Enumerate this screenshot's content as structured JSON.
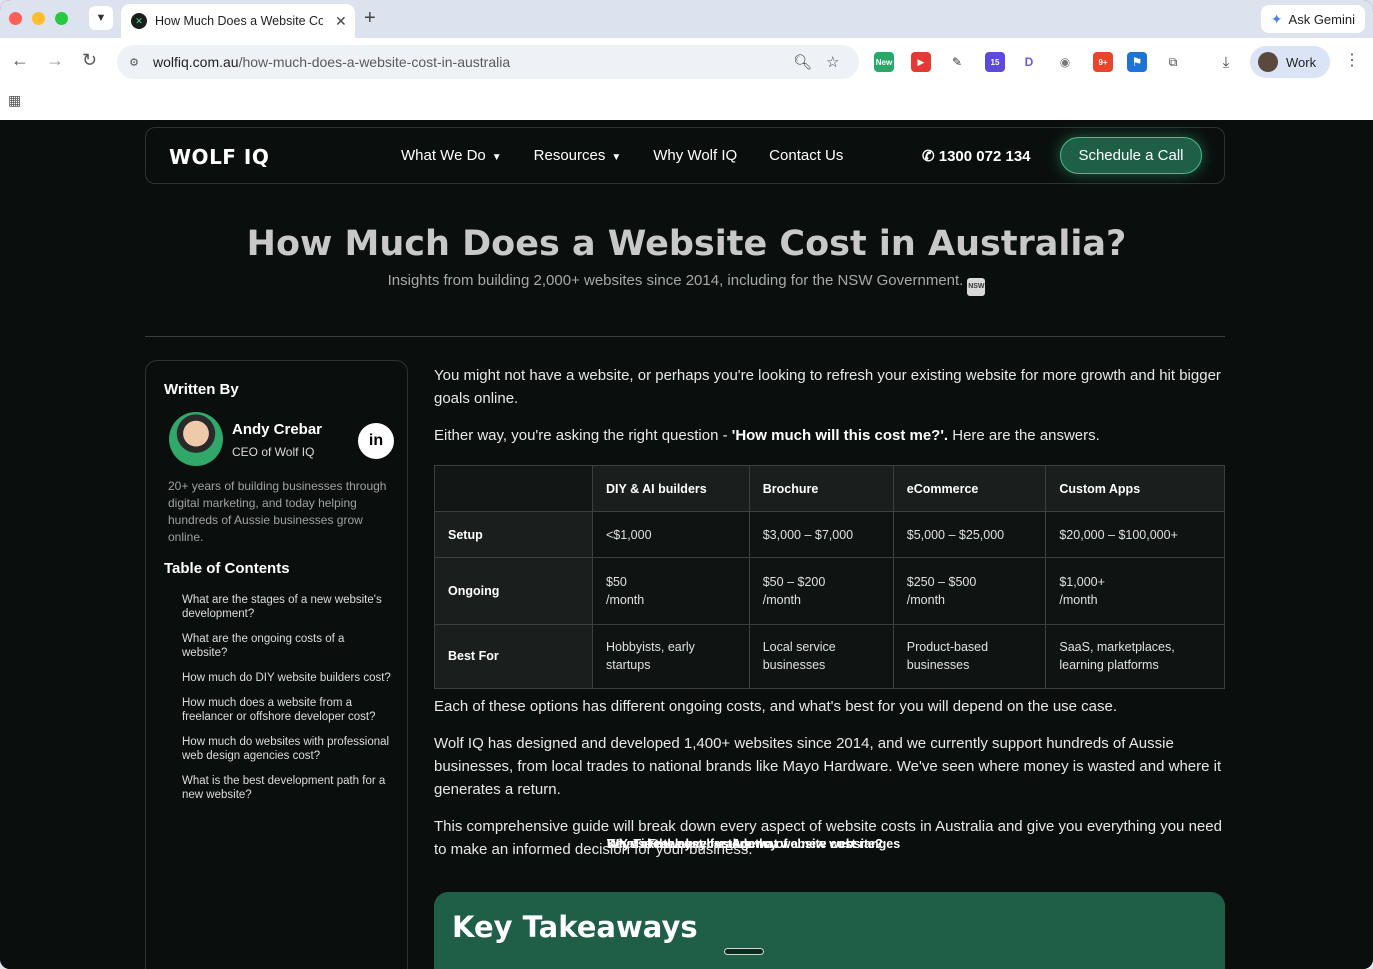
{
  "browser": {
    "tab_title": "How Much Does a Website Cost in Australia",
    "url_domain": "wolfiq.com.au",
    "url_path": "/how-much-does-a-website-cost-in-australia",
    "gemini_label": "Ask Gemini",
    "profile_label": "Work",
    "ext_badge_new": "New",
    "ext_badge_15": "15",
    "ext_badge_9": "9+"
  },
  "header": {
    "logo": "WOLF IQ",
    "nav": [
      "What We Do",
      "Resources",
      "Why Wolf IQ",
      "Contact Us"
    ],
    "phone": "1300 072 134",
    "cta": "Schedule a Call"
  },
  "hero": {
    "title": "How Much Does a Website Cost in Australia?",
    "subtitle": "Insights from building 2,000+ websites since 2014, including for the NSW Government.",
    "badge": "NSW"
  },
  "sidebar": {
    "written_by": "Written By",
    "author_name": "Andy Crebar",
    "author_role": "CEO of Wolf IQ",
    "linkedin": "in",
    "bio": "20+ years of building businesses through digital marketing, and today helping hundreds of Aussie businesses grow online.",
    "toc_title": "Table of Contents",
    "toc": [
      {
        "label": "Key Takeaways",
        "level": "main"
      },
      {
        "label": "What is the cost breakdown of a new website?",
        "level": "main"
      },
      {
        "label": "What are the stages of a new website's development?",
        "level": "sub"
      },
      {
        "label": "What are the ongoing costs of a website?",
        "level": "sub"
      },
      {
        "label": "DIY vs Freelancer vs Agency website cost ranges",
        "level": "main"
      },
      {
        "label": "How much do DIY website builders cost?",
        "level": "sub"
      },
      {
        "label": "How much does a website from a freelancer or offshore developer cost?",
        "level": "sub"
      },
      {
        "label": "How much do websites with professional web design agencies cost?",
        "level": "sub"
      },
      {
        "label": "What is the best development path for a new website?",
        "level": "sub"
      },
      {
        "label": "What are the key factors that",
        "level": "main"
      }
    ]
  },
  "content": {
    "intro1": "You might not have a website, or perhaps you're looking to refresh your existing website for more growth and hit bigger goals online.",
    "intro2_pre": "Either way, you're asking the right question - ",
    "intro2_bold": "'How much will this cost me?'.",
    "intro2_post": " Here are the answers.",
    "after1": "Each of these options has different ongoing costs, and what's best for you will depend on the use case.",
    "after2": "Wolf IQ has designed and developed 1,400+ websites since 2014, and we currently support hundreds of Aussie businesses, from local trades to national brands like Mayo Hardware. We've seen where money is wasted and where it generates a return.",
    "after3": "This comprehensive guide will break down every aspect of website costs in Australia and give you everything you need to make an informed decision for your business.",
    "takeaways_title": "Key Takeaways"
  },
  "table": {
    "columns": [
      "DIY & AI builders",
      "Brochure",
      "eCommerce",
      "Custom Apps"
    ],
    "rows": [
      {
        "label": "Setup",
        "cells": [
          [
            "<$1,000"
          ],
          [
            "$3,000 – $7,000"
          ],
          [
            "$5,000 – $25,000"
          ],
          [
            "$20,000 – $100,000+"
          ]
        ]
      },
      {
        "label": "Ongoing",
        "cells": [
          [
            "$50",
            "/month"
          ],
          [
            "$50 – $200",
            "/month"
          ],
          [
            "$250 – $500",
            "/month"
          ],
          [
            "$1,000+",
            "/month"
          ]
        ]
      },
      {
        "label": "Best For",
        "cells": [
          [
            "Hobbyists, early",
            "startups"
          ],
          [
            "Local service",
            "businesses"
          ],
          [
            "Product-based",
            "businesses"
          ],
          [
            "SaaS, marketplaces,",
            "learning platforms"
          ]
        ]
      }
    ]
  }
}
